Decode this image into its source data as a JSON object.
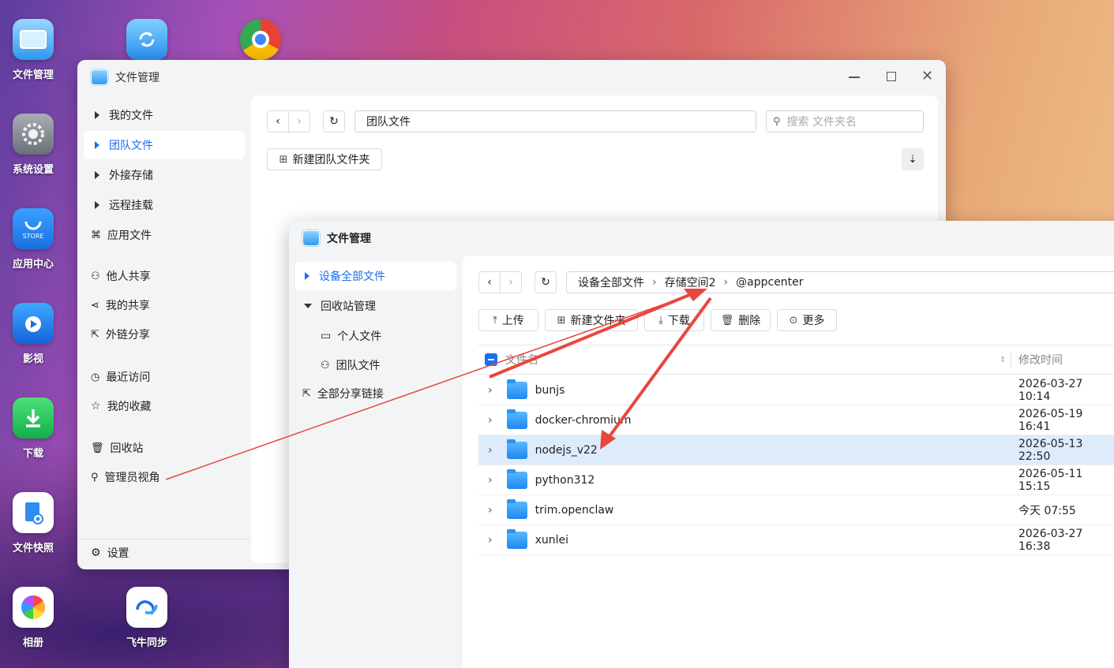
{
  "desktop": {
    "icons": [
      {
        "label": "文件管理",
        "icon": "folder-app-icon"
      },
      {
        "label": "",
        "icon": "sync-app-icon"
      },
      {
        "label": "",
        "icon": "chrome-icon"
      },
      {
        "label": "系统设置",
        "icon": "settings-gear-icon"
      },
      {
        "label": "应用中心",
        "icon": "store-icon"
      },
      {
        "label": "影视",
        "icon": "video-icon"
      },
      {
        "label": "下载",
        "icon": "download-icon"
      },
      {
        "label": "文件快照",
        "icon": "file-snapshot-icon"
      },
      {
        "label": "相册",
        "icon": "photos-icon"
      },
      {
        "label": "飞牛同步",
        "icon": "feiniu-sync-icon"
      }
    ]
  },
  "back_window": {
    "title": "文件管理",
    "sidebar": [
      {
        "label": "我的文件"
      },
      {
        "label": "团队文件"
      },
      {
        "label": "外接存储"
      },
      {
        "label": "远程挂载"
      },
      {
        "label": "应用文件"
      },
      {
        "label": "他人共享"
      },
      {
        "label": "我的共享"
      },
      {
        "label": "外链分享"
      },
      {
        "label": "最近访问"
      },
      {
        "label": "我的收藏"
      },
      {
        "label": "回收站"
      },
      {
        "label": "管理员视角"
      },
      {
        "label": "设置"
      }
    ],
    "path": "团队文件",
    "search_placeholder": "搜索 文件夹名",
    "new_team_folder": "新建团队文件夹"
  },
  "front_window": {
    "title": "文件管理",
    "sidebar": [
      {
        "label": "设备全部文件"
      },
      {
        "label": "回收站管理"
      },
      {
        "label": "个人文件"
      },
      {
        "label": "团队文件"
      },
      {
        "label": "全部分享链接"
      }
    ],
    "breadcrumb": [
      "设备全部文件",
      "存储空间2",
      "@appcenter"
    ],
    "toolbar": {
      "upload": "上传",
      "new_folder": "新建文件夹",
      "download": "下载",
      "delete": "删除",
      "more": "更多"
    },
    "columns": {
      "name": "文件名",
      "modified": "修改时间"
    },
    "rows": [
      {
        "name": "bunjs",
        "modified": "2026-03-27 10:14"
      },
      {
        "name": "docker-chromium",
        "modified": "2026-05-19 16:41"
      },
      {
        "name": "nodejs_v22",
        "modified": "2026-05-13 22:50"
      },
      {
        "name": "python312",
        "modified": "2026-05-11 15:15"
      },
      {
        "name": "trim.openclaw",
        "modified": "今天 07:55"
      },
      {
        "name": "xunlei",
        "modified": "2026-03-27 16:38"
      }
    ]
  },
  "colors": {
    "accent": "#1a6ff0",
    "selected_row": "#deebfb",
    "annotation_arrow": "#e8473f"
  }
}
